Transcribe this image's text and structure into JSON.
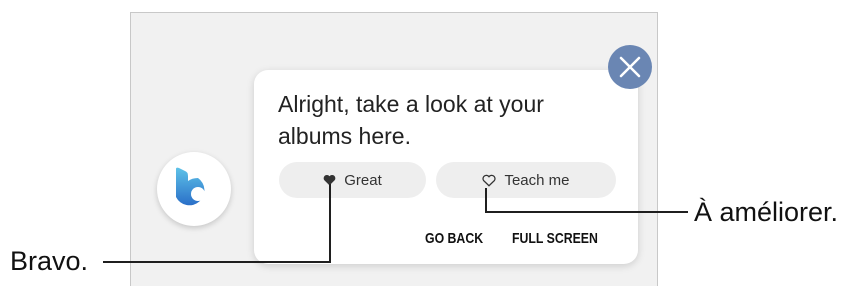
{
  "assistant": {
    "message": "Alright, take a look at your albums here.",
    "feedback": {
      "great_label": "Great",
      "teach_label": "Teach me"
    },
    "actions": {
      "go_back": "GO BACK",
      "full_screen": "FULL SCREEN"
    }
  },
  "callouts": {
    "left": "Bravo.",
    "right": "À améliorer."
  },
  "icons": {
    "close": "close-icon",
    "bixby": "bixby-logo-icon",
    "great": "heart-filled-icon",
    "teach": "heart-outline-icon"
  },
  "colors": {
    "close_button": "#6a86b3",
    "bixby_gradient_top": "#5ec2e8",
    "bixby_gradient_bottom": "#2a6fc8"
  }
}
